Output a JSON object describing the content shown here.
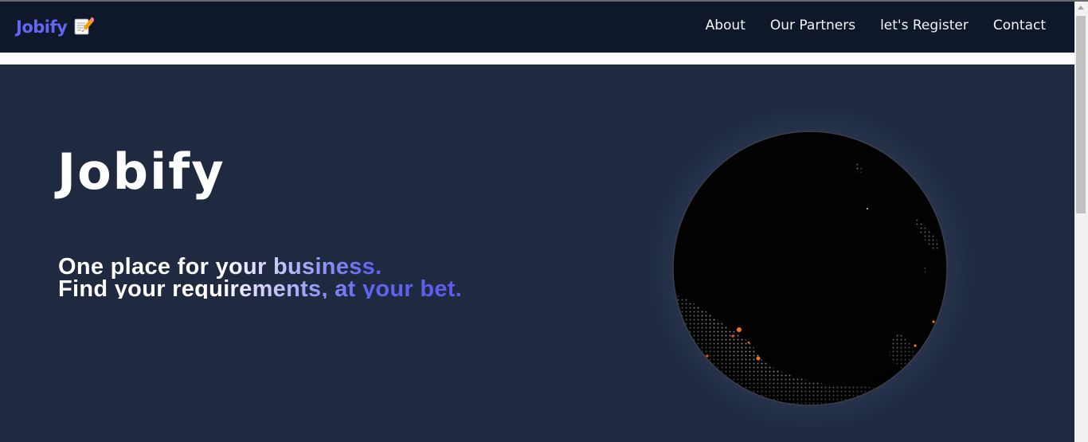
{
  "navbar": {
    "logo_text": "Jobify",
    "logo_icon": "memo-pencil-icon",
    "links": [
      "About",
      "Our Partners",
      "let's Register",
      "Contact"
    ]
  },
  "hero": {
    "title": "Jobify",
    "tagline_line1": "One place for your business.",
    "tagline_line2": "Find your requirements, at your bet."
  },
  "colors": {
    "navbar_bg": "#0f172a",
    "hero_bg": "#1f2a40",
    "brand": "#6366f1",
    "gradient_from": "#ffffff",
    "gradient_to": "#4f46e5"
  }
}
